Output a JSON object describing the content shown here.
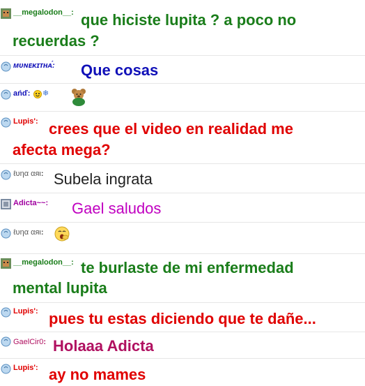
{
  "colors": {
    "green": "#1a7d1a",
    "blue": "#1010b8",
    "red": "#e00000",
    "purple": "#a000a0",
    "magenta": "#c000c0",
    "dark": "#222222",
    "gaelcir": "#b01060"
  },
  "messages": [
    {
      "nick": "__megalodon__",
      "text": "que hiciste lupita ? a poco no",
      "text2": "recuerdas ?"
    },
    {
      "nick": "ᴍᴜɴᴇᴋɪᴛʜᴀ́",
      "text": "Que cosas"
    },
    {
      "nick": "ańď:",
      "text": ""
    },
    {
      "nick": "Lupis'",
      "text": "crees que el video en realidad me",
      "text2": "afecta mega?"
    },
    {
      "nick": "ℓυηα αяι",
      "text": "Subela ingrata"
    },
    {
      "nick": "Adicta~~",
      "text": "Gael saludos"
    },
    {
      "nick": "ℓυηα αяι",
      "text": ""
    },
    {
      "nick": "__megalodon__",
      "text": "te burlaste de mi enfermedad",
      "text2": "mental lupita"
    },
    {
      "nick": "Lupis'",
      "text": "pues tu estas diciendo que te dañe..."
    },
    {
      "nick": "GaelCir0",
      "text": "Holaaa Adicta"
    },
    {
      "nick": "Lupis'",
      "text": "ay no mames"
    }
  ]
}
